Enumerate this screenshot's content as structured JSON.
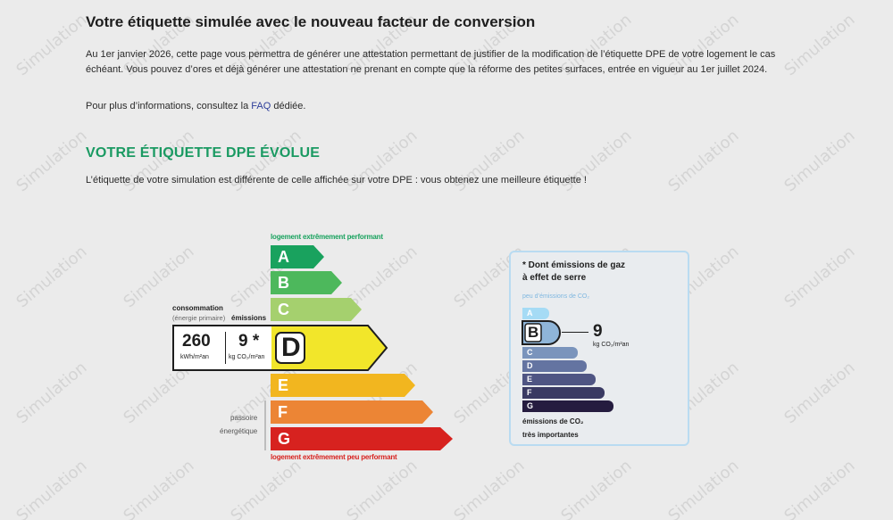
{
  "header": {
    "title": "Votre étiquette simulée avec le nouveau facteur de conversion",
    "intro": "Au 1er janvier 2026, cette page vous permettra de générer une attestation permettant de justifier de la modification de l’étiquette DPE de votre logement le cas échéant. Vous pouvez d’ores et déjà générer une attestation ne prenant en compte que la réforme des petites surfaces, entrée en vigueur au 1er juillet 2024.",
    "info_prefix": "Pour plus d’informations, consultez la",
    "faq_link": "FAQ",
    "info_suffix": "dédiée."
  },
  "section": {
    "title": "VOTRE ÉTIQUETTE DPE ÉVOLUE",
    "subtitle": "L’étiquette de votre simulation est différente de celle affichée sur votre DPE : vous obtenez une meilleure étiquette !"
  },
  "dpe": {
    "top_label": "logement extrêmement performant",
    "bottom_label": "logement extrêmement peu performant",
    "consumption_label": "consommation",
    "consumption_sub": "(énergie primaire)",
    "emissions_label": "émissions",
    "consumption_value": "260",
    "consumption_unit": "kWh/m²an",
    "emissions_value": "9 *",
    "emissions_unit": "kg CO₂/m²an",
    "current_class": "D",
    "side_label_1": "passoire",
    "side_label_2": "énergétique",
    "classes": [
      {
        "letter": "A",
        "color": "#19a25e"
      },
      {
        "letter": "B",
        "color": "#4db85c"
      },
      {
        "letter": "C",
        "color": "#a5d06e"
      },
      {
        "letter": "D",
        "color": "#f2e62a"
      },
      {
        "letter": "E",
        "color": "#f2b61f"
      },
      {
        "letter": "F",
        "color": "#ec8535"
      },
      {
        "letter": "G",
        "color": "#d7221f"
      }
    ]
  },
  "co2": {
    "title_1": "* Dont émissions de gaz",
    "title_2": "à effet de serre",
    "top_label": "peu d’émissions de CO₂",
    "value": "9",
    "unit": "kg CO₂/m²an",
    "current_class": "B",
    "bottom_label_1": "émissions de CO₂",
    "bottom_label_2": "très importantes",
    "classes": [
      {
        "letter": "A",
        "color": "#a5dbf5"
      },
      {
        "letter": "B",
        "color": "#8fb5d8"
      },
      {
        "letter": "C",
        "color": "#7a94bc"
      },
      {
        "letter": "D",
        "color": "#6474a1"
      },
      {
        "letter": "E",
        "color": "#4f5583"
      },
      {
        "letter": "F",
        "color": "#3a3a63"
      },
      {
        "letter": "G",
        "color": "#251c3f"
      }
    ]
  },
  "watermark_text": "Simulation"
}
